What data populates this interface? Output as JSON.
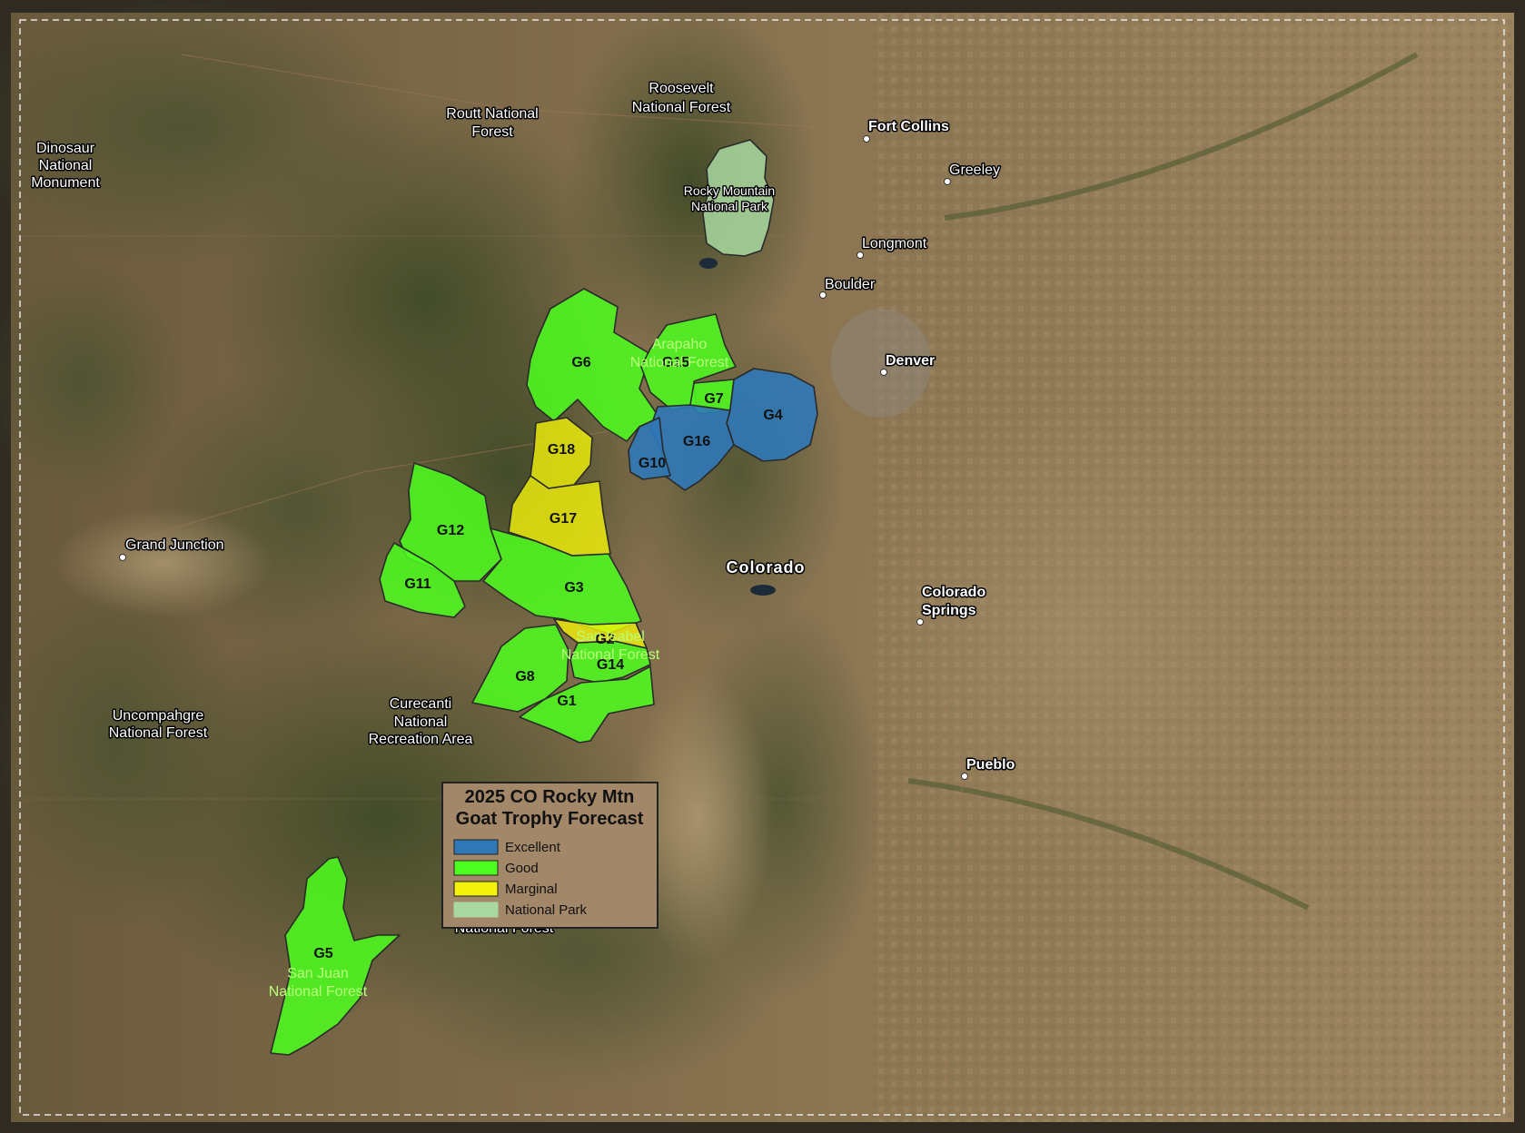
{
  "map": {
    "legend": {
      "title_line1": "2025 CO Rocky Mtn",
      "title_line2": "Goat Trophy Forecast",
      "items": [
        {
          "label": "Excellent",
          "color": "#2f78b7"
        },
        {
          "label": "Good",
          "color": "#4dff1f"
        },
        {
          "label": "Marginal",
          "color": "#f2f20a"
        },
        {
          "label": "National Park",
          "color": "#a8d8a0"
        }
      ]
    },
    "units": {
      "G1": "G1",
      "G2": "G2",
      "G3": "G3",
      "G4": "G4",
      "G5": "G5",
      "G6": "G6",
      "G7": "G7",
      "G8": "G8",
      "G10": "G10",
      "G11": "G11",
      "G12": "G12",
      "G14": "G14",
      "G15": "G15",
      "G16": "G16",
      "G17": "G17",
      "G18": "G18"
    },
    "places": {
      "dinosaur": [
        "Dinosaur",
        "National",
        "Monument"
      ],
      "routt": [
        "Routt National",
        "Forest"
      ],
      "roosevelt": [
        "Roosevelt",
        "National Forest"
      ],
      "rmnp": [
        "Rocky Mountain",
        "National Park"
      ],
      "arapaho": [
        "Arapaho",
        "National Forest"
      ],
      "sanisabel": [
        "San Isabel",
        "National Forest"
      ],
      "curecanti": [
        "Curecanti",
        "National",
        "Recreation Area"
      ],
      "uncompahgre": [
        "Uncompahgre",
        "National Forest"
      ],
      "sanjuan": [
        "San Juan",
        "National Forest"
      ],
      "riogrande_partial": "National Forest",
      "state": "Colorado"
    },
    "cities": {
      "fort_collins": "Fort Collins",
      "greeley": "Greeley",
      "longmont": "Longmont",
      "boulder": "Boulder",
      "denver": "Denver",
      "colorado_springs": [
        "Colorado",
        "Springs"
      ],
      "pueblo": "Pueblo",
      "grand_junction": "Grand Junction"
    }
  }
}
